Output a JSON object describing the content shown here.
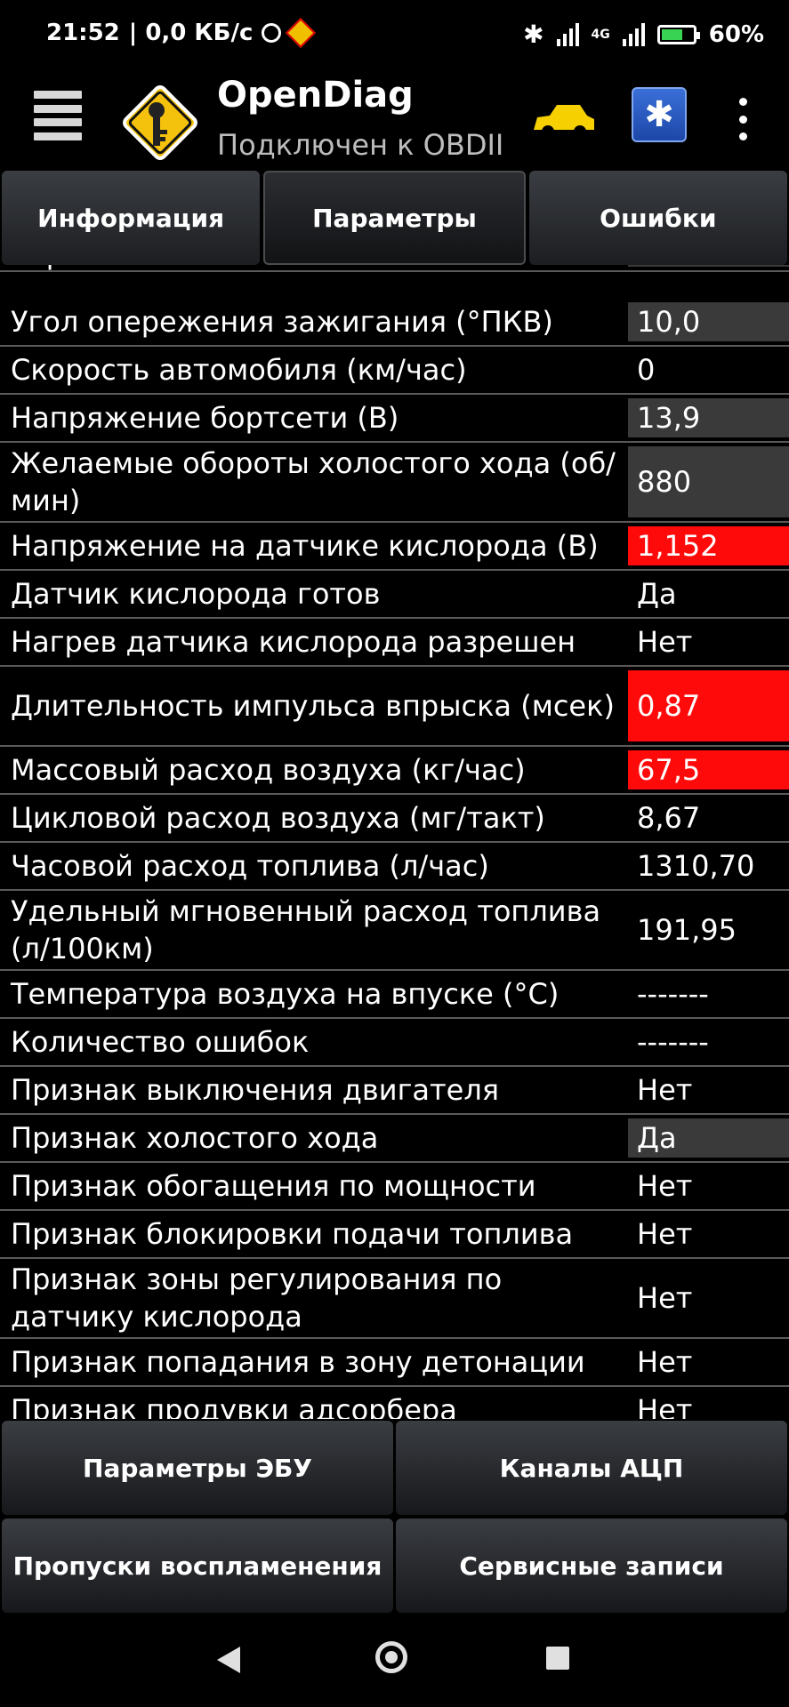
{
  "status_bar": {
    "time": "21:52",
    "speed": "| 0,0 КБ/с",
    "network": "4G",
    "battery": "60%"
  },
  "app": {
    "title": "OpenDiag",
    "subtitle": "Подключен к OBDII",
    "bt_label": "✱"
  },
  "tabs": [
    {
      "label": "Информация"
    },
    {
      "label": "Параметры"
    },
    {
      "label": "Ошибки"
    }
  ],
  "params": [
    {
      "label": "впрыска",
      "value": "",
      "style": "gray"
    },
    {
      "label": "Угол опережения зажигания (°ПКВ)",
      "value": "10,0",
      "style": "gray"
    },
    {
      "label": "Скорость автомобиля (км/час)",
      "value": "0",
      "style": ""
    },
    {
      "label": "Напряжение бортсети (В)",
      "value": "13,9",
      "style": "gray"
    },
    {
      "label": "Желаемые обороты холостого хода (об/мин)",
      "value": "880",
      "style": "gray"
    },
    {
      "label": "Напряжение на датчике кислорода (В)",
      "value": "1,152",
      "style": "red"
    },
    {
      "label": "Датчик кислорода готов",
      "value": "Да",
      "style": ""
    },
    {
      "label": "Нагрев датчика кислорода разрешен",
      "value": "Нет",
      "style": ""
    },
    {
      "label": "Длительность импульса впрыска (мсек)",
      "value": "0,87",
      "style": "red"
    },
    {
      "label": "Массовый расход воздуха (кг/час)",
      "value": "67,5",
      "style": "red"
    },
    {
      "label": "Цикловой расход воздуха (мг/такт)",
      "value": "8,67",
      "style": ""
    },
    {
      "label": "Часовой расход топлива (л/час)",
      "value": "1310,70",
      "style": ""
    },
    {
      "label": "Удельный мгновенный расход топлива (л/100км)",
      "value": "191,95",
      "style": ""
    },
    {
      "label": "Температура воздуха на впуске (°C)",
      "value": "-------",
      "style": ""
    },
    {
      "label": "Количество ошибок",
      "value": "-------",
      "style": ""
    },
    {
      "label": "Признак выключения двигателя",
      "value": "Нет",
      "style": ""
    },
    {
      "label": "Признак холостого хода",
      "value": "Да",
      "style": "gray"
    },
    {
      "label": "Признак обогащения по мощности",
      "value": "Нет",
      "style": ""
    },
    {
      "label": "Признак блокировки подачи топлива",
      "value": "Нет",
      "style": ""
    },
    {
      "label": "Признак зоны регулирования по датчику кислорода",
      "value": "Нет",
      "style": ""
    },
    {
      "label": "Признак попадания в зону детонации",
      "value": "Нет",
      "style": ""
    },
    {
      "label": "Признак продувки адсорбера",
      "value": "Нет",
      "style": ""
    }
  ],
  "buttons": [
    {
      "label": "Параметры ЭБУ"
    },
    {
      "label": "Каналы АЦП"
    },
    {
      "label": "Пропуски воспламенения"
    },
    {
      "label": "Сервисные записи"
    }
  ]
}
